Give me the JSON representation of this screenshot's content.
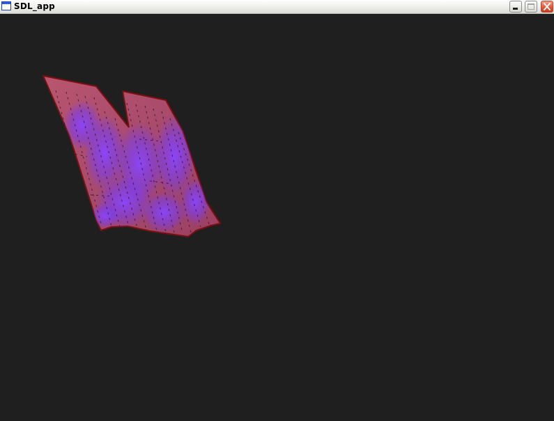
{
  "window": {
    "title": "SDL_app",
    "buttons": {
      "minimize": "minimize-icon",
      "maximize": "maximize-icon",
      "close": "close-icon"
    }
  },
  "scene": {
    "background_color": "#1f1f1f",
    "cloth_fill_color": "#b04a6c",
    "cloth_glow_color": "#7a3cff",
    "cloth_edge_color": "#7a1010"
  }
}
